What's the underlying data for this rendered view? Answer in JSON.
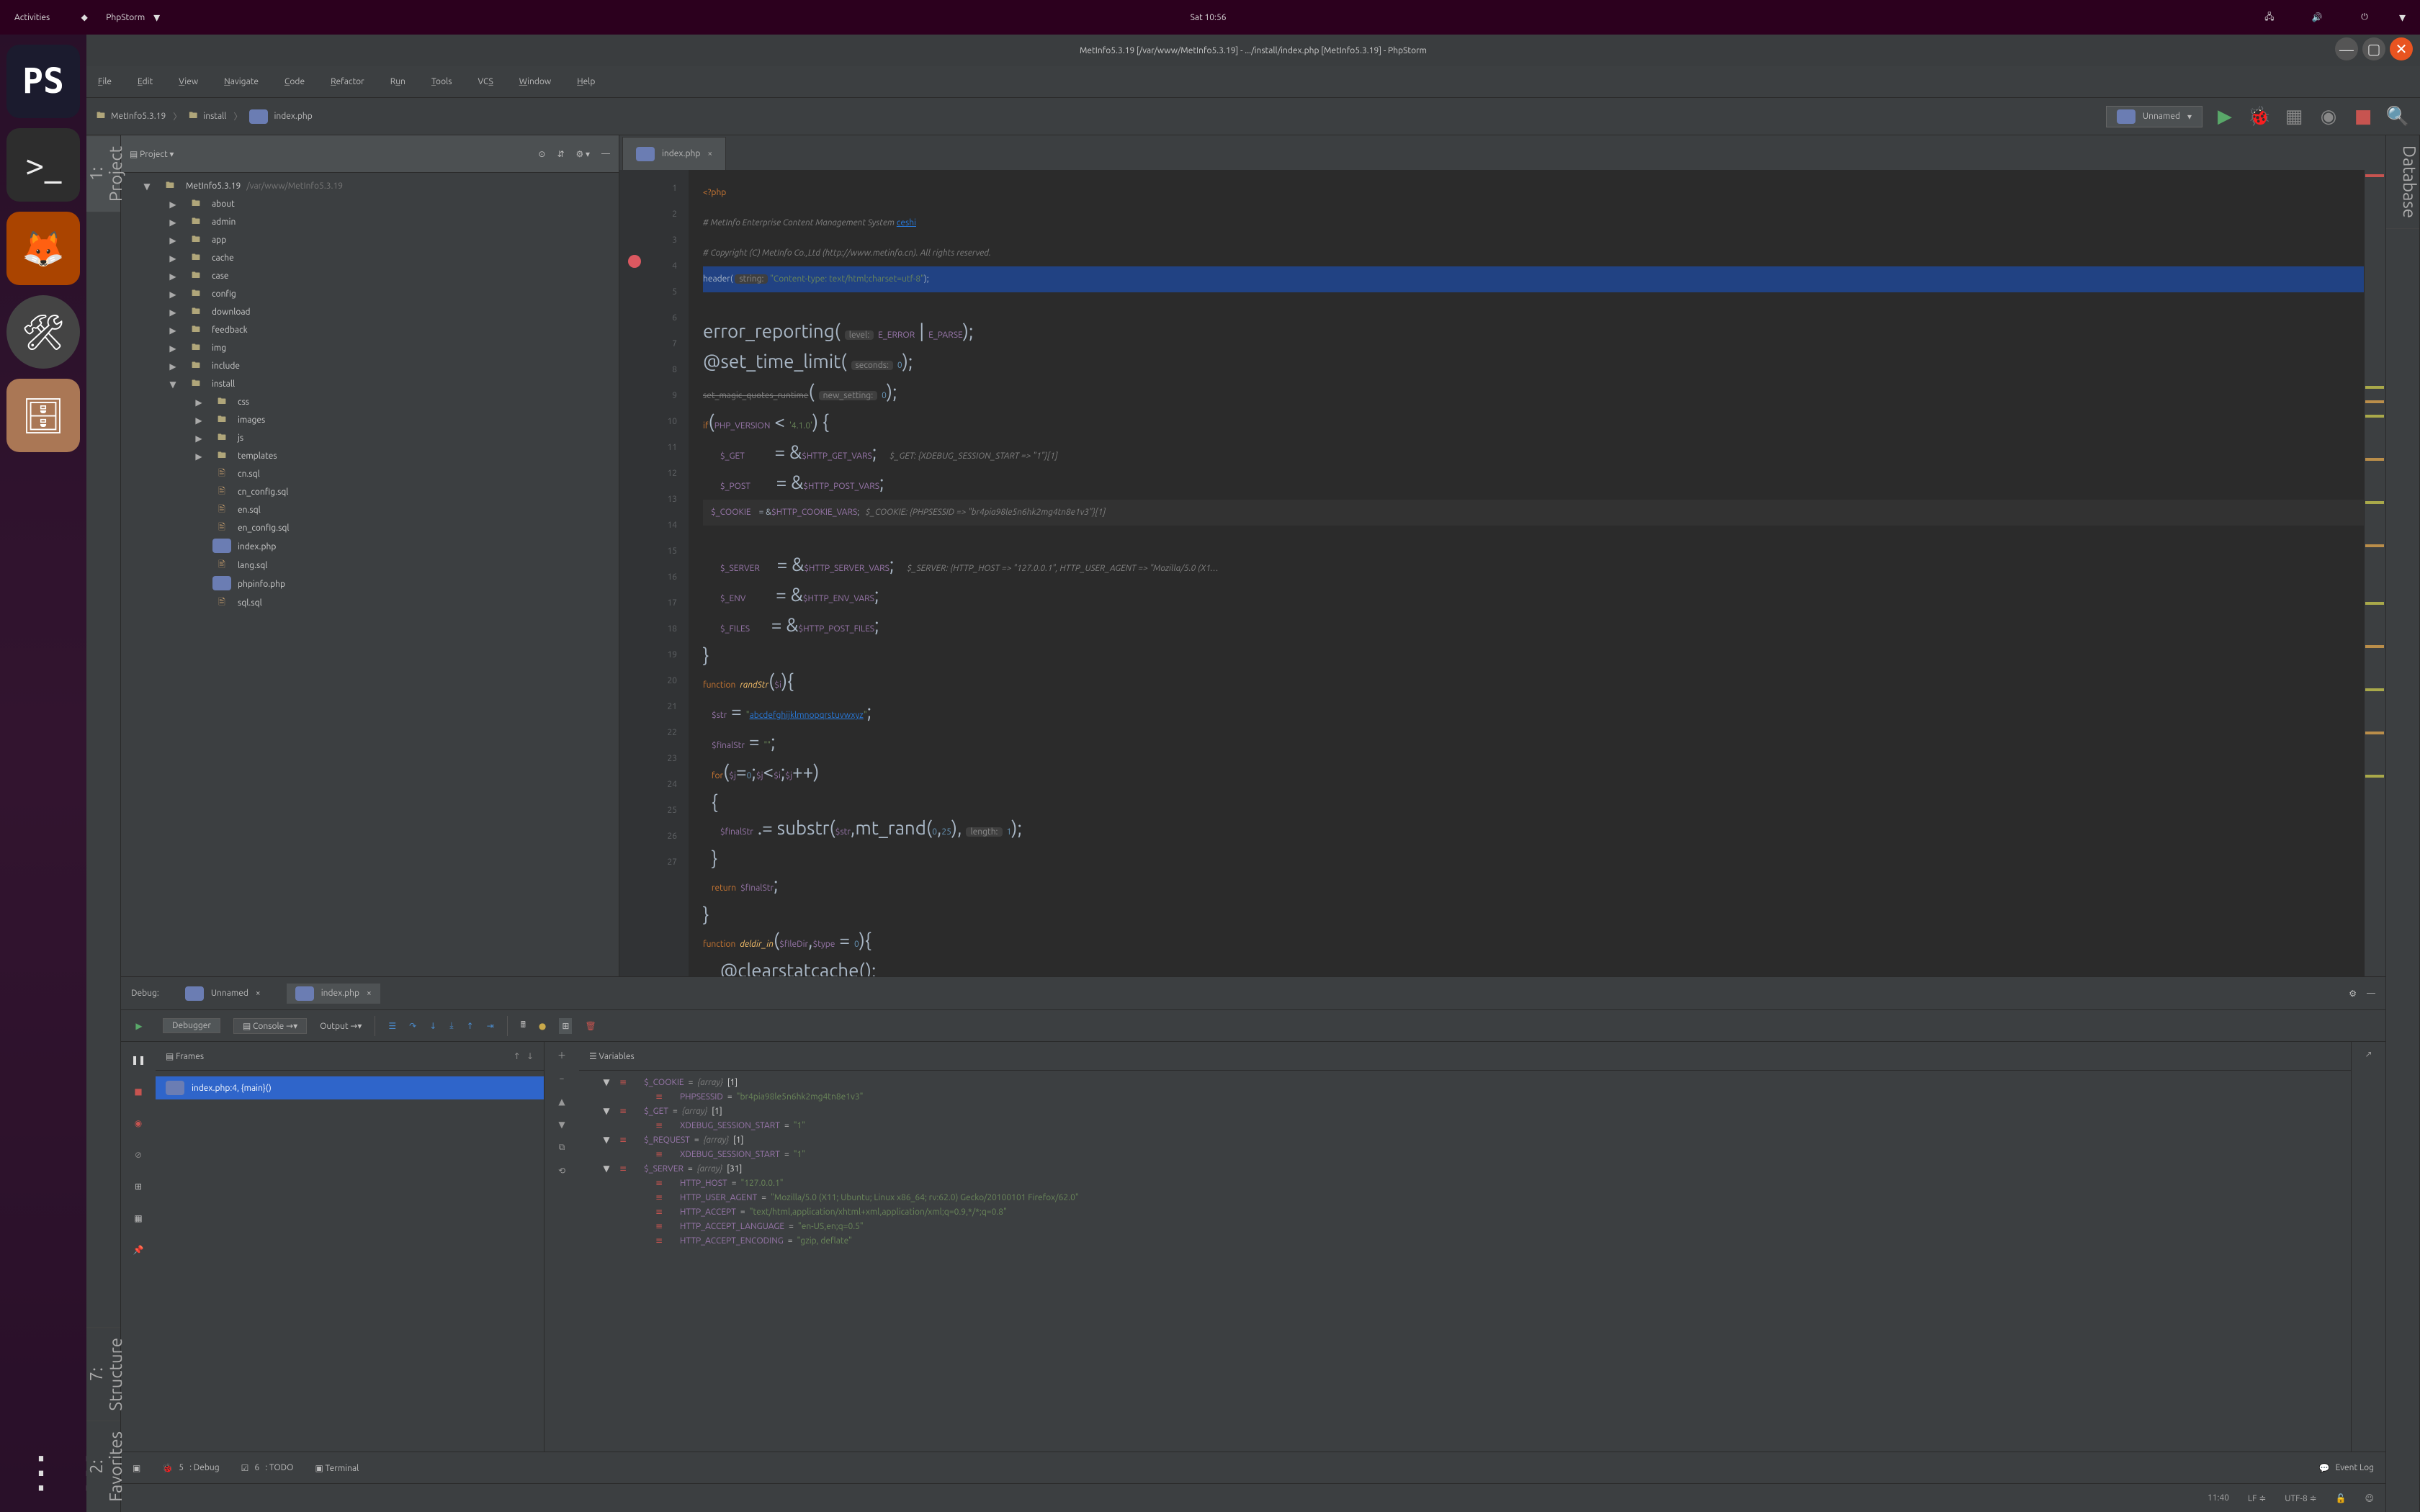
{
  "gnome": {
    "activities": "Activities",
    "app_name": "PhpStorm",
    "clock": "Sat 10:56"
  },
  "launcher": {
    "items": [
      "ps",
      "terminal",
      "firefox",
      "tools",
      "files"
    ]
  },
  "window_title": "MetInfo5.3.19 [/var/www/MetInfo5.3.19] - .../install/index.php [MetInfo5.3.19] - PhpStorm",
  "menu": [
    "File",
    "Edit",
    "View",
    "Navigate",
    "Code",
    "Refactor",
    "Run",
    "Tools",
    "VCS",
    "Window",
    "Help"
  ],
  "breadcrumbs": [
    {
      "icon": "folder",
      "label": "MetInfo5.3.19"
    },
    {
      "icon": "folder",
      "label": "install"
    },
    {
      "icon": "php",
      "label": "index.php"
    }
  ],
  "run_config_label": "Unnamed",
  "project_header": "Project",
  "tree": [
    {
      "d": 0,
      "exp": "▼",
      "icon": "folder",
      "label": "MetInfo5.3.19",
      "suffix": "/var/www/MetInfo5.3.19"
    },
    {
      "d": 1,
      "exp": "▶",
      "icon": "folder",
      "label": "about"
    },
    {
      "d": 1,
      "exp": "▶",
      "icon": "folder",
      "label": "admin"
    },
    {
      "d": 1,
      "exp": "▶",
      "icon": "folder",
      "label": "app"
    },
    {
      "d": 1,
      "exp": "▶",
      "icon": "folder",
      "label": "cache"
    },
    {
      "d": 1,
      "exp": "▶",
      "icon": "folder",
      "label": "case"
    },
    {
      "d": 1,
      "exp": "▶",
      "icon": "folder",
      "label": "config"
    },
    {
      "d": 1,
      "exp": "▶",
      "icon": "folder",
      "label": "download"
    },
    {
      "d": 1,
      "exp": "▶",
      "icon": "folder",
      "label": "feedback"
    },
    {
      "d": 1,
      "exp": "▶",
      "icon": "folder",
      "label": "img"
    },
    {
      "d": 1,
      "exp": "▶",
      "icon": "folder",
      "label": "include"
    },
    {
      "d": 1,
      "exp": "▼",
      "icon": "folder",
      "label": "install"
    },
    {
      "d": 2,
      "exp": "▶",
      "icon": "folder",
      "label": "css"
    },
    {
      "d": 2,
      "exp": "▶",
      "icon": "folder",
      "label": "images"
    },
    {
      "d": 2,
      "exp": "▶",
      "icon": "folder",
      "label": "js"
    },
    {
      "d": 2,
      "exp": "▶",
      "icon": "folder",
      "label": "templates"
    },
    {
      "d": 2,
      "exp": "",
      "icon": "sql",
      "label": "cn.sql"
    },
    {
      "d": 2,
      "exp": "",
      "icon": "sql",
      "label": "cn_config.sql"
    },
    {
      "d": 2,
      "exp": "",
      "icon": "sql",
      "label": "en.sql"
    },
    {
      "d": 2,
      "exp": "",
      "icon": "sql",
      "label": "en_config.sql"
    },
    {
      "d": 2,
      "exp": "",
      "icon": "php",
      "label": "index.php"
    },
    {
      "d": 2,
      "exp": "",
      "icon": "sql",
      "label": "lang.sql"
    },
    {
      "d": 2,
      "exp": "",
      "icon": "php",
      "label": "phpinfo.php"
    },
    {
      "d": 2,
      "exp": "",
      "icon": "sql",
      "label": "sql.sql"
    }
  ],
  "editor_tab": "index.php",
  "line_count": 27,
  "debug": {
    "title": "Debug:",
    "tabs": [
      {
        "label": "Unnamed",
        "icon": "php"
      },
      {
        "label": "index.php",
        "icon": "php",
        "active": true
      }
    ],
    "subtabs": {
      "debugger": "Debugger",
      "console": "Console",
      "output": "Output"
    },
    "frames_title": "Frames",
    "frame_caret": "↑ ↓",
    "frames": [
      {
        "label": "index.php:4, {main}()",
        "selected": true
      }
    ],
    "vars_title": "Variables",
    "vars": [
      {
        "d": 0,
        "exp": "▼",
        "name": "$_COOKIE",
        "type": "{array}",
        "count": "[1]"
      },
      {
        "d": 1,
        "exp": "",
        "name": "PHPSESSID",
        "val": "\"br4pia98le5n6hk2mg4tn8e1v3\""
      },
      {
        "d": 0,
        "exp": "▼",
        "name": "$_GET",
        "type": "{array}",
        "count": "[1]"
      },
      {
        "d": 1,
        "exp": "",
        "name": "XDEBUG_SESSION_START",
        "val": "\"1\""
      },
      {
        "d": 0,
        "exp": "▼",
        "name": "$_REQUEST",
        "type": "{array}",
        "count": "[1]"
      },
      {
        "d": 1,
        "exp": "",
        "name": "XDEBUG_SESSION_START",
        "val": "\"1\""
      },
      {
        "d": 0,
        "exp": "▼",
        "name": "$_SERVER",
        "type": "{array}",
        "count": "[31]"
      },
      {
        "d": 1,
        "exp": "",
        "name": "HTTP_HOST",
        "val": "\"127.0.0.1\""
      },
      {
        "d": 1,
        "exp": "",
        "name": "HTTP_USER_AGENT",
        "val": "\"Mozilla/5.0 (X11; Ubuntu; Linux x86_64; rv:62.0) Gecko/20100101 Firefox/62.0\""
      },
      {
        "d": 1,
        "exp": "",
        "name": "HTTP_ACCEPT",
        "val": "\"text/html,application/xhtml+xml,application/xml;q=0.9,*/*;q=0.8\""
      },
      {
        "d": 1,
        "exp": "",
        "name": "HTTP_ACCEPT_LANGUAGE",
        "val": "\"en-US,en;q=0.5\""
      },
      {
        "d": 1,
        "exp": "",
        "name": "HTTP_ACCEPT_ENCODING",
        "val": "\"gzip, deflate\""
      }
    ]
  },
  "bottom_tools": [
    {
      "icon": "▣",
      "label": ""
    },
    {
      "icon": "",
      "label": "5: Debug",
      "underline": "5"
    },
    {
      "icon": "",
      "label": "6: TODO",
      "underline": "6"
    },
    {
      "icon": "",
      "label": "Terminal"
    }
  ],
  "event_log": "Event Log",
  "status": {
    "caret": "11:40",
    "sep": "LF",
    "enc": "UTF-8"
  },
  "side_left": [
    "1: Project",
    "7: Structure",
    "2: Favorites"
  ],
  "side_right": [
    "Database"
  ]
}
